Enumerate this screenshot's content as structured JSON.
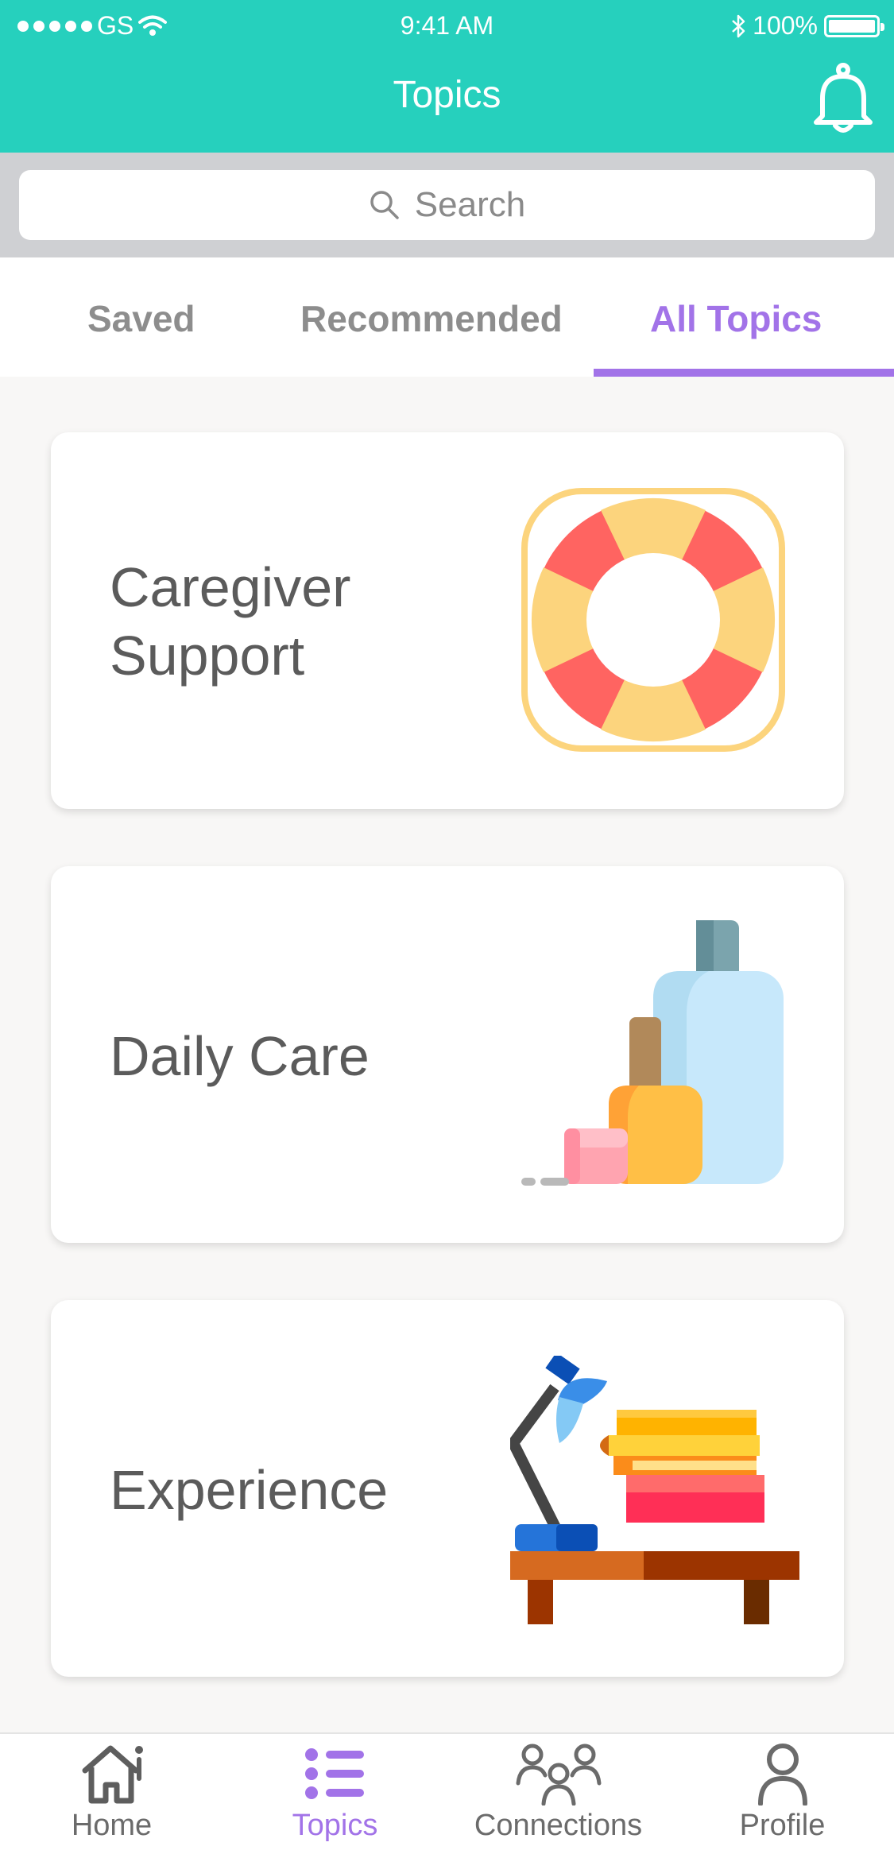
{
  "status_bar": {
    "carrier": "GS",
    "time": "9:41 AM",
    "battery": "100%"
  },
  "header": {
    "title": "Topics",
    "bell_icon": "bell-icon"
  },
  "search": {
    "placeholder": "Search",
    "icon": "search-icon"
  },
  "tabs": [
    {
      "label": "Saved",
      "active": false
    },
    {
      "label": "Recommended",
      "active": false
    },
    {
      "label": "All Topics",
      "active": true
    }
  ],
  "cards": [
    {
      "label": "Caregiver Support",
      "icon": "lifebuoy-icon"
    },
    {
      "label": "Daily Care",
      "icon": "toiletries-icon"
    },
    {
      "label": "Experience",
      "icon": "desk-lamp-books-icon"
    }
  ],
  "bottom_nav": [
    {
      "label": "Home",
      "icon": "home-icon",
      "active": false
    },
    {
      "label": "Topics",
      "icon": "list-icon",
      "active": true
    },
    {
      "label": "Connections",
      "icon": "people-icon",
      "active": false
    },
    {
      "label": "Profile",
      "icon": "person-icon",
      "active": false
    }
  ],
  "colors": {
    "header": "#26d0bd",
    "accent": "#a273e8",
    "text": "#5b5b5b"
  }
}
